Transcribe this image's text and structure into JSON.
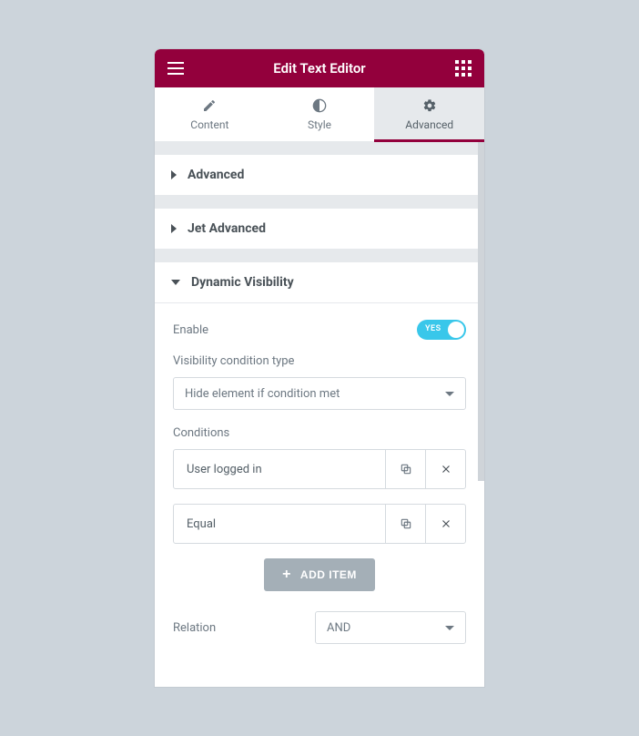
{
  "header": {
    "title": "Edit Text Editor"
  },
  "tabs": [
    {
      "label": "Content",
      "icon": "pencil"
    },
    {
      "label": "Style",
      "icon": "contrast"
    },
    {
      "label": "Advanced",
      "icon": "gear",
      "active": true
    }
  ],
  "accordions": {
    "advanced": "Advanced",
    "jet_advanced": "Jet Advanced",
    "dynamic_visibility": "Dynamic Visibility"
  },
  "dyn": {
    "enable_label": "Enable",
    "enable_value": "YES",
    "type_label": "Visibility condition type",
    "type_value": "Hide element if condition met",
    "conditions_label": "Conditions",
    "conditions": [
      {
        "label": "User logged in"
      },
      {
        "label": "Equal"
      }
    ],
    "add_item": "ADD ITEM",
    "relation_label": "Relation",
    "relation_value": "AND"
  }
}
